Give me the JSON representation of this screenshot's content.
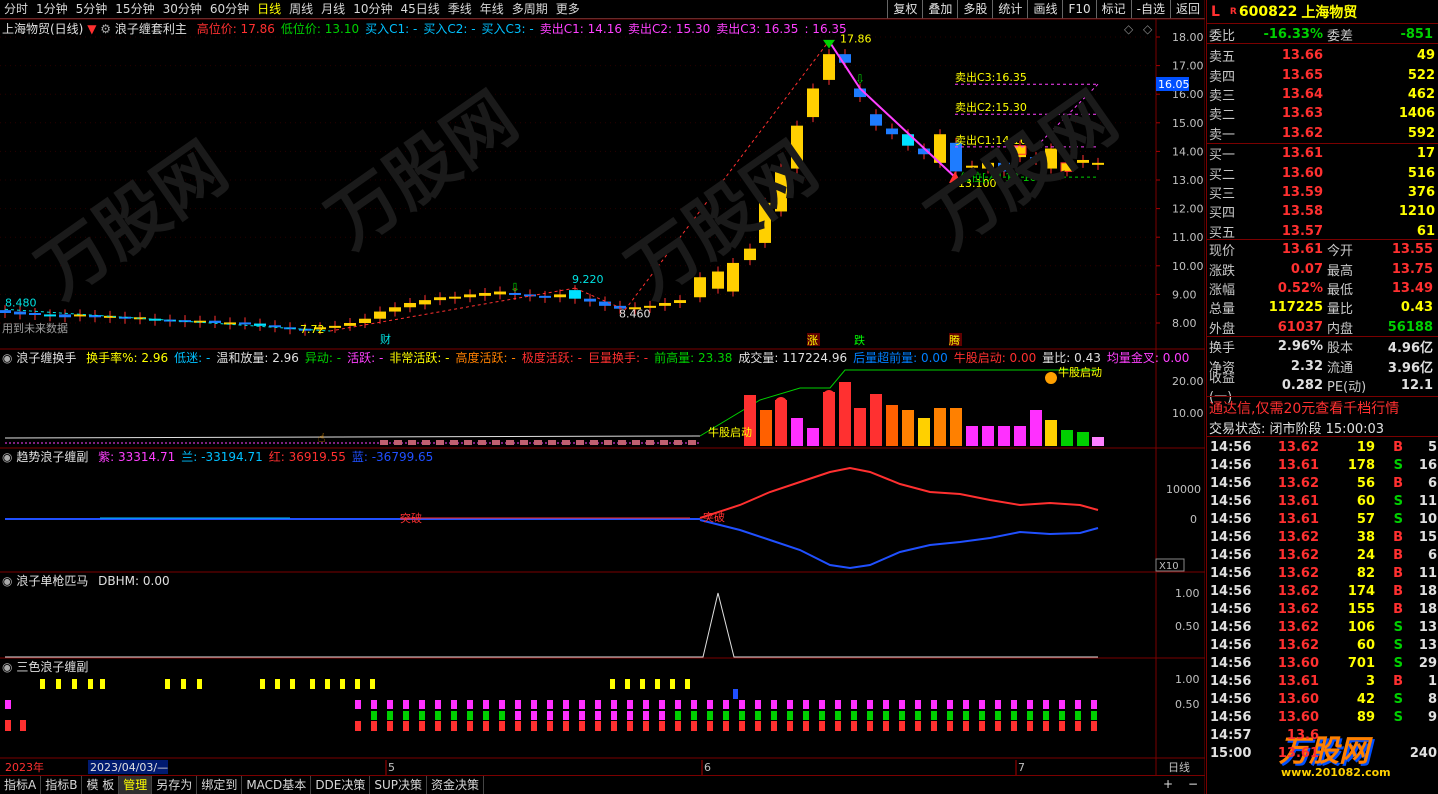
{
  "periods": [
    "分时",
    "1分钟",
    "5分钟",
    "15分钟",
    "30分钟",
    "60分钟",
    "日线",
    "周线",
    "月线",
    "10分钟",
    "45日线",
    "季线",
    "年线",
    "多周期",
    "更多"
  ],
  "selected_period": "日线",
  "top_buttons": [
    "复权",
    "叠加",
    "多股",
    "统计",
    "画线",
    "F10",
    "标记",
    "-自选",
    "返回"
  ],
  "main_panel": {
    "title": "上海物贸(日线)",
    "indicator": "浪子缠套利主",
    "items": [
      {
        "text": "高位价: 17.86",
        "color": "#ff3030"
      },
      {
        "text": "低位价: 13.10",
        "color": "#00d000"
      },
      {
        "text": "买入C1: -",
        "color": "#00c0ff"
      },
      {
        "text": "买入C2: -",
        "color": "#00c0ff"
      },
      {
        "text": "买入C3: -",
        "color": "#00c0ff"
      },
      {
        "text": "卖出C1: 14.16",
        "color": "#ff40ff"
      },
      {
        "text": "卖出C2: 15.30",
        "color": "#ff40ff"
      },
      {
        "text": "卖出C3: 16.35",
        "color": "#ff40ff"
      },
      {
        "text": ": 16.35",
        "color": "#ff40ff"
      }
    ],
    "y_ticks": [
      "18.00",
      "17.00",
      "16.00",
      "15.00",
      "14.00",
      "13.00",
      "12.00",
      "11.00",
      "10.00",
      "9.00",
      "8.00"
    ],
    "current_price_tag": "16.05",
    "annotations": {
      "high": "17.86",
      "low_label": "低位[入] 13.10",
      "low_val": "13.100",
      "sell_c3": "卖出C3:16.35",
      "sell_c2": "卖出C2:15.30",
      "sell_c1": "卖出C1:14.16",
      "left_high": "8.480",
      "left_low": "7.72",
      "mid_high": "9.220",
      "mid_low": "8.460",
      "future_note": "用到未来数据",
      "cai": "财",
      "zhang": "涨",
      "die": "跌",
      "teng": "腾"
    }
  },
  "panel2": {
    "title": "浪子缠换手",
    "items": [
      {
        "text": "换手率%: 2.96",
        "color": "#ffff00"
      },
      {
        "text": "低迷: -",
        "color": "#00c0ff"
      },
      {
        "text": "温和放量: 2.96",
        "color": "#e0e0e0"
      },
      {
        "text": "异动: -",
        "color": "#00d000"
      },
      {
        "text": "活跃: -",
        "color": "#ff40ff"
      },
      {
        "text": "非常活跃: -",
        "color": "#ffff00"
      },
      {
        "text": "高度活跃: -",
        "color": "#ff8000"
      },
      {
        "text": "极度活跃: -",
        "color": "#ff3030"
      },
      {
        "text": "巨量换手: -",
        "color": "#ff3030"
      },
      {
        "text": "前高量: 23.38",
        "color": "#00d000"
      },
      {
        "text": "成交量: 117224.96",
        "color": "#e0e0e0"
      },
      {
        "text": "后量超前量: 0.00",
        "color": "#0080ff"
      },
      {
        "text": "牛股启动: 0.00",
        "color": "#ff3030"
      },
      {
        "text": "量比: 0.43",
        "color": "#e0e0e0"
      },
      {
        "text": "均量金叉: 0.00",
        "color": "#ff40ff"
      }
    ],
    "y_ticks": [
      "20.00",
      "10.00"
    ],
    "labels": {
      "niu": "牛股启动",
      "niu2": "牛股启动"
    }
  },
  "panel3": {
    "title": "趋势浪子缠副",
    "items": [
      {
        "text": "紫: 33314.71",
        "color": "#ff40ff"
      },
      {
        "text": "兰: -33194.71",
        "color": "#00c0ff"
      },
      {
        "text": "红: 36919.55",
        "color": "#ff3030"
      },
      {
        "text": "蓝: -36799.65",
        "color": "#2050ff"
      }
    ],
    "y_ticks": [
      "10000",
      "0"
    ],
    "scale": "X10",
    "labels": {
      "tu1": "突破",
      "tu2": "突破"
    }
  },
  "panel4": {
    "title": "浪子单枪匹马",
    "items": [
      {
        "text": "DBHM: 0.00",
        "color": "#e0e0e0"
      }
    ],
    "y_ticks": [
      "1.00",
      "0.50"
    ]
  },
  "panel5": {
    "title": "三色浪子缠副",
    "y_ticks": [
      "1.00",
      "0.50"
    ]
  },
  "x_axis": {
    "year": "2023年",
    "date": "2023/04/03/—",
    "m5": "5",
    "m6": "6",
    "m7": "7",
    "period": "日线"
  },
  "bottom_tabs": [
    "指标A",
    "指标B",
    "模 板",
    "管理",
    "另存为",
    "绑定到",
    "MACD基本",
    "DDE决策",
    "SUP决策",
    "资金决策"
  ],
  "selected_tab": "管理",
  "quote": {
    "flag": "L",
    "r": "R",
    "code": "600822",
    "name": "上海物贸",
    "webi_label": "委比",
    "webi": "-16.33%",
    "weicha_label": "委差",
    "weicha": "-851",
    "asks": [
      {
        "label": "卖五",
        "price": "13.66",
        "vol": "49"
      },
      {
        "label": "卖四",
        "price": "13.65",
        "vol": "522"
      },
      {
        "label": "卖三",
        "price": "13.64",
        "vol": "462"
      },
      {
        "label": "卖二",
        "price": "13.63",
        "vol": "1406"
      },
      {
        "label": "卖一",
        "price": "13.62",
        "vol": "592"
      }
    ],
    "bids": [
      {
        "label": "买一",
        "price": "13.61",
        "vol": "17"
      },
      {
        "label": "买二",
        "price": "13.60",
        "vol": "516"
      },
      {
        "label": "买三",
        "price": "13.59",
        "vol": "376"
      },
      {
        "label": "买四",
        "price": "13.58",
        "vol": "1210"
      },
      {
        "label": "买五",
        "price": "13.57",
        "vol": "61"
      }
    ],
    "stats": [
      {
        "l1": "现价",
        "v1": "13.61",
        "c1": "red",
        "l2": "今开",
        "v2": "13.55",
        "c2": "red"
      },
      {
        "l1": "涨跌",
        "v1": "0.07",
        "c1": "red",
        "l2": "最高",
        "v2": "13.75",
        "c2": "red"
      },
      {
        "l1": "涨幅",
        "v1": "0.52%",
        "c1": "red",
        "l2": "最低",
        "v2": "13.49",
        "c2": "red"
      },
      {
        "l1": "总量",
        "v1": "117225",
        "c1": "yel",
        "l2": "量比",
        "v2": "0.43",
        "c2": "yel"
      },
      {
        "l1": "外盘",
        "v1": "61037",
        "c1": "red",
        "l2": "内盘",
        "v2": "56188",
        "c2": "grn"
      }
    ],
    "stats2": [
      {
        "l1": "换手",
        "v1": "2.96%",
        "c1": "wht",
        "l2": "股本",
        "v2": "4.96亿",
        "c2": "wht"
      },
      {
        "l1": "净资",
        "v1": "2.32",
        "c1": "wht",
        "l2": "流通",
        "v2": "3.96亿",
        "c2": "wht"
      },
      {
        "l1": "收益(一)",
        "v1": "0.282",
        "c1": "wht",
        "l2": "PE(动)",
        "v2": "12.1",
        "c2": "wht"
      }
    ],
    "promo": "通达信,仅需20元查看千档行情",
    "status": "交易状态: 闭市阶段 15:00:03",
    "ticks": [
      {
        "t": "14:56",
        "p": "13.62",
        "pc": "red",
        "v": "19",
        "bs": "B",
        "n": "5"
      },
      {
        "t": "14:56",
        "p": "13.61",
        "pc": "red",
        "v": "178",
        "bs": "S",
        "n": "16"
      },
      {
        "t": "14:56",
        "p": "13.62",
        "pc": "red",
        "v": "56",
        "bs": "B",
        "n": "6"
      },
      {
        "t": "14:56",
        "p": "13.61",
        "pc": "red",
        "v": "60",
        "bs": "S",
        "n": "11"
      },
      {
        "t": "14:56",
        "p": "13.61",
        "pc": "red",
        "v": "57",
        "bs": "S",
        "n": "10"
      },
      {
        "t": "14:56",
        "p": "13.62",
        "pc": "red",
        "v": "38",
        "bs": "B",
        "n": "15"
      },
      {
        "t": "14:56",
        "p": "13.62",
        "pc": "red",
        "v": "24",
        "bs": "B",
        "n": "6"
      },
      {
        "t": "14:56",
        "p": "13.62",
        "pc": "red",
        "v": "82",
        "bs": "B",
        "n": "11"
      },
      {
        "t": "14:56",
        "p": "13.62",
        "pc": "red",
        "v": "174",
        "bs": "B",
        "n": "18"
      },
      {
        "t": "14:56",
        "p": "13.62",
        "pc": "red",
        "v": "155",
        "bs": "B",
        "n": "18"
      },
      {
        "t": "14:56",
        "p": "13.62",
        "pc": "red",
        "v": "106",
        "bs": "S",
        "n": "13"
      },
      {
        "t": "14:56",
        "p": "13.62",
        "pc": "red",
        "v": "60",
        "bs": "S",
        "n": "13"
      },
      {
        "t": "14:56",
        "p": "13.60",
        "pc": "red",
        "v": "701",
        "bs": "S",
        "n": "29",
        "vc": "mag"
      },
      {
        "t": "14:56",
        "p": "13.61",
        "pc": "red",
        "v": "3",
        "bs": "B",
        "n": "1"
      },
      {
        "t": "14:56",
        "p": "13.60",
        "pc": "red",
        "v": "42",
        "bs": "S",
        "n": "8"
      },
      {
        "t": "14:56",
        "p": "13.60",
        "pc": "red",
        "v": "89",
        "bs": "S",
        "n": "9"
      },
      {
        "t": "14:57",
        "p": "13.6",
        "pc": "red",
        "v": "",
        "bs": "",
        "n": ""
      },
      {
        "t": "15:00",
        "p": "13.61",
        "pc": "red",
        "v": "",
        "bs": "",
        "n": "240"
      }
    ]
  },
  "watermark": "万股网",
  "watermark2": "www.201082.com",
  "colors": {
    "up": "#ff3030",
    "down": "#00d000",
    "grid": "#7a0000",
    "candle_up": "#ffd000",
    "candle_dn": "#1060ff"
  }
}
